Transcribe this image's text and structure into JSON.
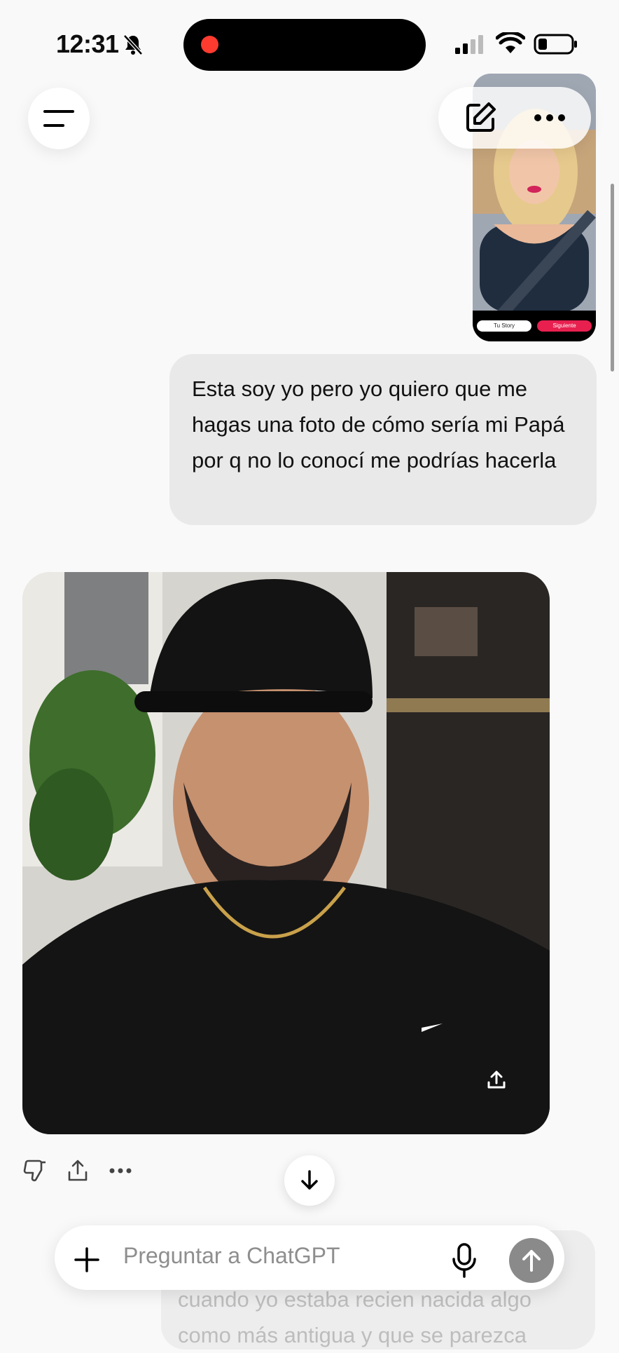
{
  "status_bar": {
    "time": "12:31"
  },
  "thumbnail": {
    "left_chip": "Tu Story",
    "right_chip": "Siguiente"
  },
  "user_message": {
    "text": "Esta soy yo pero yo quiero que me hagas una foto de cómo sería mi Papá por q no lo conocí me podrías hacerla"
  },
  "next_message_partial": {
    "lines": [
      "cuando yo estaba recien nacida algo",
      "como más antigua y que se parezca"
    ]
  },
  "composer": {
    "placeholder": "Preguntar a ChatGPT"
  },
  "icons": {
    "menu": "menu-icon",
    "new_chat": "edit-icon",
    "more": "more-icon",
    "dislike": "thumbs-down-icon",
    "share": "share-icon",
    "scroll_down": "arrow-down-icon",
    "add": "plus-icon",
    "mic": "mic-icon",
    "send": "arrow-up-icon"
  },
  "colors": {
    "bubble": "#e9e9ea",
    "recording_dot": "#ff3b30",
    "send_button": "#8a8a8a",
    "siguiente_chip": "#e8204f"
  }
}
